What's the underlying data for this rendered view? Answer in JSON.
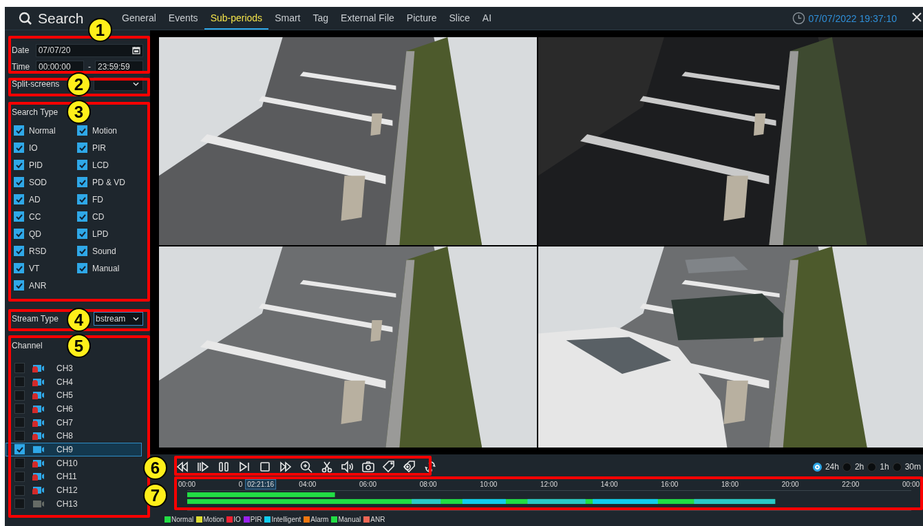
{
  "header": {
    "title": "Search",
    "datetime": "07/07/2022 19:37:10"
  },
  "tabs": [
    {
      "label": "General",
      "selected": false
    },
    {
      "label": "Events",
      "selected": false
    },
    {
      "label": "Sub-periods",
      "selected": true
    },
    {
      "label": "Smart",
      "selected": false
    },
    {
      "label": "Tag",
      "selected": false
    },
    {
      "label": "External File",
      "selected": false
    },
    {
      "label": "Picture",
      "selected": false
    },
    {
      "label": "Slice",
      "selected": false
    },
    {
      "label": "AI",
      "selected": false
    }
  ],
  "date": {
    "label": "Date",
    "value": "07/07/20"
  },
  "time": {
    "label": "Time",
    "start": "00:00:00",
    "separator": "-",
    "end": "23:59:59"
  },
  "split_screens": {
    "label": "Split-screens"
  },
  "search_type": {
    "title": "Search Type",
    "options": [
      {
        "label": "Normal",
        "checked": true
      },
      {
        "label": "Motion",
        "checked": true
      },
      {
        "label": "IO",
        "checked": true
      },
      {
        "label": "PIR",
        "checked": true
      },
      {
        "label": "PID",
        "checked": true
      },
      {
        "label": "LCD",
        "checked": true
      },
      {
        "label": "SOD",
        "checked": true
      },
      {
        "label": "PD & VD",
        "checked": true
      },
      {
        "label": "AD",
        "checked": true
      },
      {
        "label": "FD",
        "checked": true
      },
      {
        "label": "CC",
        "checked": true
      },
      {
        "label": "CD",
        "checked": true
      },
      {
        "label": "QD",
        "checked": true
      },
      {
        "label": "LPD",
        "checked": true
      },
      {
        "label": "RSD",
        "checked": true
      },
      {
        "label": "Sound",
        "checked": true
      },
      {
        "label": "VT",
        "checked": true
      },
      {
        "label": "Manual",
        "checked": true
      },
      {
        "label": "ANR",
        "checked": true
      }
    ]
  },
  "stream_type": {
    "label": "Stream Type",
    "value": "bstream"
  },
  "channel": {
    "title": "Channel",
    "items": [
      {
        "label": "CH3",
        "kind": "alarm",
        "checked": false,
        "selected": false
      },
      {
        "label": "CH4",
        "kind": "alarm",
        "checked": false,
        "selected": false
      },
      {
        "label": "CH5",
        "kind": "alarm",
        "checked": false,
        "selected": false
      },
      {
        "label": "CH6",
        "kind": "alarm",
        "checked": false,
        "selected": false
      },
      {
        "label": "CH7",
        "kind": "alarm",
        "checked": false,
        "selected": false
      },
      {
        "label": "CH8",
        "kind": "alarm",
        "checked": false,
        "selected": false
      },
      {
        "label": "CH9",
        "kind": "normal",
        "checked": true,
        "selected": true
      },
      {
        "label": "CH10",
        "kind": "alarm",
        "checked": false,
        "selected": false
      },
      {
        "label": "CH11",
        "kind": "alarm",
        "checked": false,
        "selected": false
      },
      {
        "label": "CH12",
        "kind": "alarm",
        "checked": false,
        "selected": false
      },
      {
        "label": "CH13",
        "kind": "offline",
        "checked": false,
        "selected": false
      }
    ]
  },
  "controls": [
    {
      "kind": "rewind"
    },
    {
      "kind": "slow"
    },
    {
      "kind": "pause"
    },
    {
      "kind": "next"
    },
    {
      "kind": "stop"
    },
    {
      "kind": "fast-forward"
    },
    {
      "kind": "zoom"
    },
    {
      "kind": "clip"
    },
    {
      "kind": "volume"
    },
    {
      "kind": "snapshot"
    },
    {
      "kind": "tag"
    },
    {
      "kind": "tag-add"
    },
    {
      "kind": "switch"
    }
  ],
  "ranges": [
    {
      "label": "24h",
      "selected": true
    },
    {
      "label": "2h",
      "selected": false
    },
    {
      "label": "1h",
      "selected": false
    },
    {
      "label": "30m",
      "selected": false
    }
  ],
  "timeline": {
    "ticks": [
      "00:00",
      "0",
      "04:00",
      "06:00",
      "08:00",
      "10:00",
      "12:00",
      "14:00",
      "16:00",
      "18:00",
      "20:00",
      "22:00",
      "00:00"
    ],
    "cursor": {
      "time": "02:21:16",
      "level": 0.098
    }
  },
  "legend": [
    {
      "label": "Normal",
      "color": "#22dd44"
    },
    {
      "label": "Motion",
      "color": "#dddd33"
    },
    {
      "label": "IO",
      "color": "#ee2233"
    },
    {
      "label": "PIR",
      "color": "#9922ee"
    },
    {
      "label": "Intelligent",
      "color": "#11ccee"
    },
    {
      "label": "Alarm",
      "color": "#ee7711"
    },
    {
      "label": "Manual",
      "color": "#22dd44"
    },
    {
      "label": "ANR",
      "color": "#ee6655"
    }
  ],
  "callouts": [
    {
      "number": "1"
    },
    {
      "number": "2"
    },
    {
      "number": "3"
    },
    {
      "number": "4"
    },
    {
      "number": "5"
    },
    {
      "number": "6"
    },
    {
      "number": "7"
    }
  ]
}
